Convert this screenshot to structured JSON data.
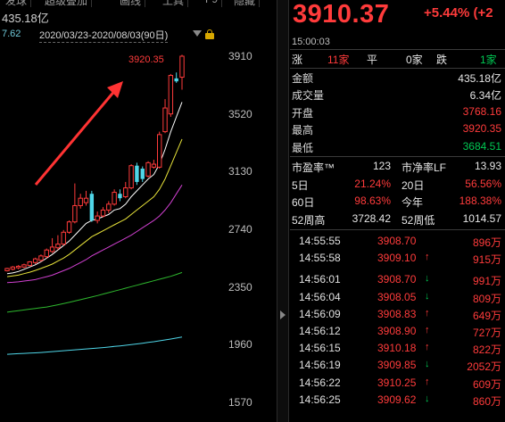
{
  "top_tabs": [
    "发球",
    "超级叠加",
    "画线",
    "工具",
    "F9",
    "隐藏"
  ],
  "amount_info": "435.18亿",
  "range": {
    "prev_value": "7.62",
    "date_range": "2020/03/23-2020/08/03(90日)"
  },
  "chart_data": {
    "type": "candlestick",
    "y_ticks": [
      "3910",
      "3520",
      "3130",
      "2740",
      "2350",
      "1960",
      "1570"
    ],
    "y_tick_values": [
      3910,
      3520,
      3130,
      2740,
      2350,
      1960,
      1570
    ],
    "high_label": "3920.35",
    "high_value": 3920.35,
    "ylim": [
      1400,
      4070
    ],
    "candles": [
      {
        "o": 2460,
        "c": 2475,
        "h": 2480,
        "l": 2455,
        "up": true
      },
      {
        "o": 2470,
        "c": 2485,
        "h": 2492,
        "l": 2462,
        "up": true
      },
      {
        "o": 2480,
        "c": 2490,
        "h": 2498,
        "l": 2470,
        "up": true
      },
      {
        "o": 2485,
        "c": 2500,
        "h": 2508,
        "l": 2478,
        "up": true
      },
      {
        "o": 2495,
        "c": 2520,
        "h": 2525,
        "l": 2490,
        "up": true
      },
      {
        "o": 2515,
        "c": 2540,
        "h": 2548,
        "l": 2505,
        "up": true
      },
      {
        "o": 2530,
        "c": 2560,
        "h": 2570,
        "l": 2520,
        "up": true
      },
      {
        "o": 2555,
        "c": 2600,
        "h": 2610,
        "l": 2545,
        "up": true
      },
      {
        "o": 2590,
        "c": 2620,
        "h": 2680,
        "l": 2580,
        "up": true
      },
      {
        "o": 2615,
        "c": 2640,
        "h": 2700,
        "l": 2600,
        "up": true
      },
      {
        "o": 2640,
        "c": 2720,
        "h": 2735,
        "l": 2630,
        "up": true
      },
      {
        "o": 2720,
        "c": 2790,
        "h": 2800,
        "l": 2710,
        "up": true
      },
      {
        "o": 2790,
        "c": 2900,
        "h": 3050,
        "l": 2780,
        "up": true
      },
      {
        "o": 2900,
        "c": 2950,
        "h": 2980,
        "l": 2880,
        "up": true
      },
      {
        "o": 2950,
        "c": 2920,
        "h": 3000,
        "l": 2900,
        "up": true
      },
      {
        "o": 2980,
        "c": 2800,
        "h": 3000,
        "l": 2790,
        "up": false
      },
      {
        "o": 2800,
        "c": 2830,
        "h": 2860,
        "l": 2780,
        "up": true
      },
      {
        "o": 2830,
        "c": 2870,
        "h": 2890,
        "l": 2820,
        "up": true
      },
      {
        "o": 2870,
        "c": 2910,
        "h": 2930,
        "l": 2850,
        "up": true
      },
      {
        "o": 2910,
        "c": 2990,
        "h": 3010,
        "l": 2900,
        "up": true
      },
      {
        "o": 2980,
        "c": 2950,
        "h": 3010,
        "l": 2930,
        "up": false
      },
      {
        "o": 2960,
        "c": 3020,
        "h": 3060,
        "l": 2950,
        "up": true
      },
      {
        "o": 3020,
        "c": 3170,
        "h": 3180,
        "l": 3010,
        "up": true
      },
      {
        "o": 3170,
        "c": 3060,
        "h": 3190,
        "l": 3040,
        "up": false
      },
      {
        "o": 3080,
        "c": 3150,
        "h": 3165,
        "l": 3060,
        "up": false
      },
      {
        "o": 3100,
        "c": 3190,
        "h": 3200,
        "l": 3090,
        "up": true
      },
      {
        "o": 3180,
        "c": 3160,
        "h": 3210,
        "l": 3150,
        "up": true
      },
      {
        "o": 3160,
        "c": 3380,
        "h": 3400,
        "l": 3150,
        "up": true
      },
      {
        "o": 3400,
        "c": 3560,
        "h": 3620,
        "l": 3390,
        "up": true
      },
      {
        "o": 3520,
        "c": 3780,
        "h": 3790,
        "l": 3500,
        "up": true
      },
      {
        "o": 3760,
        "c": 3740,
        "h": 3800,
        "l": 3730,
        "up": false
      },
      {
        "o": 3768,
        "c": 3910,
        "h": 3920,
        "l": 3684,
        "up": true
      }
    ],
    "ma_series": [
      {
        "color": "#ffffff",
        "values": [
          2440,
          2445,
          2455,
          2470,
          2485,
          2500,
          2520,
          2545,
          2570,
          2600,
          2630,
          2660,
          2700,
          2740,
          2780,
          2800,
          2810,
          2825,
          2840,
          2870,
          2880,
          2910,
          2960,
          3000,
          3040,
          3080,
          3110,
          3180,
          3280,
          3400,
          3500,
          3600
        ]
      },
      {
        "color": "#e8e33a",
        "values": [
          2420,
          2425,
          2430,
          2440,
          2450,
          2462,
          2475,
          2490,
          2505,
          2525,
          2545,
          2570,
          2600,
          2630,
          2660,
          2690,
          2710,
          2730,
          2750,
          2770,
          2790,
          2810,
          2840,
          2870,
          2900,
          2930,
          2960,
          3010,
          3080,
          3170,
          3260,
          3350
        ]
      },
      {
        "color": "#d040d0",
        "values": [
          2380,
          2382,
          2385,
          2390,
          2395,
          2400,
          2410,
          2420,
          2430,
          2445,
          2460,
          2475,
          2495,
          2515,
          2535,
          2560,
          2580,
          2600,
          2620,
          2640,
          2660,
          2680,
          2700,
          2725,
          2750,
          2775,
          2800,
          2830,
          2870,
          2920,
          2980,
          3040
        ]
      },
      {
        "color": "#2eb82e",
        "values": [
          2180,
          2185,
          2190,
          2195,
          2200,
          2205,
          2210,
          2215,
          2222,
          2230,
          2238,
          2246,
          2255,
          2264,
          2273,
          2282,
          2292,
          2302,
          2312,
          2322,
          2332,
          2342,
          2352,
          2362,
          2372,
          2382,
          2392,
          2402,
          2412,
          2422,
          2435,
          2448
        ]
      },
      {
        "color": "#4fd6e8",
        "values": [
          1895,
          1897,
          1899,
          1901,
          1903,
          1905,
          1907,
          1910,
          1913,
          1916,
          1919,
          1922,
          1925,
          1928,
          1931,
          1934,
          1937,
          1940,
          1944,
          1948,
          1952,
          1956,
          1960,
          1965,
          1970,
          1975,
          1980,
          1986,
          1992,
          1998,
          2005,
          2012
        ]
      }
    ]
  },
  "quote": {
    "price": "3910.37",
    "change": "+5.44% (+2",
    "time": "15:00:03",
    "breadth": {
      "up_label": "涨",
      "up_count": "11家",
      "flat_label": "平",
      "flat_count": "0家",
      "down_label": "跌",
      "down_count": "1家"
    },
    "stats": [
      {
        "label": "金额",
        "value": "435.18亿",
        "color": "white"
      },
      {
        "label": "成交量",
        "value": "6.34亿",
        "color": "white"
      },
      {
        "label": "开盘",
        "value": "3768.16",
        "color": "red"
      },
      {
        "label": "最高",
        "value": "3920.35",
        "color": "red"
      },
      {
        "label": "最低",
        "value": "3684.51",
        "color": "green"
      }
    ],
    "grid": [
      {
        "l1": "市盈率™",
        "v1": "123",
        "c1": "white",
        "l2": "市净率LF",
        "v2": "13.93",
        "c2": "white"
      },
      {
        "l1": "5日",
        "v1": "21.24%",
        "c1": "red",
        "l2": "20日",
        "v2": "56.56%",
        "c2": "red"
      },
      {
        "l1": "60日",
        "v1": "98.63%",
        "c1": "red",
        "l2": "今年",
        "v2": "188.38%",
        "c2": "red"
      },
      {
        "l1": "52周高",
        "v1": "3728.42",
        "c1": "white",
        "l2": "52周低",
        "v2": "1014.57",
        "c2": "white"
      }
    ],
    "trades": [
      {
        "time": "14:55:55",
        "price": "3908.70",
        "dir": "",
        "vol": "896万",
        "pc": "red"
      },
      {
        "time": "14:55:58",
        "price": "3909.10",
        "dir": "up",
        "vol": "915万",
        "pc": "red"
      },
      {
        "time": "14:56:01",
        "price": "3908.70",
        "dir": "down",
        "vol": "991万",
        "pc": "red"
      },
      {
        "time": "14:56:04",
        "price": "3908.05",
        "dir": "down",
        "vol": "809万",
        "pc": "red"
      },
      {
        "time": "14:56:09",
        "price": "3908.83",
        "dir": "up",
        "vol": "649万",
        "pc": "red"
      },
      {
        "time": "14:56:12",
        "price": "3908.90",
        "dir": "up",
        "vol": "727万",
        "pc": "red"
      },
      {
        "time": "14:56:15",
        "price": "3910.18",
        "dir": "up",
        "vol": "822万",
        "pc": "red"
      },
      {
        "time": "14:56:19",
        "price": "3909.85",
        "dir": "down",
        "vol": "2052万",
        "pc": "red"
      },
      {
        "time": "14:56:22",
        "price": "3910.25",
        "dir": "up",
        "vol": "609万",
        "pc": "red"
      },
      {
        "time": "14:56:25",
        "price": "3909.62",
        "dir": "down",
        "vol": "860万",
        "pc": "red"
      }
    ]
  },
  "colors": {
    "up": "#ff3b3b",
    "down": "#4fd6e8",
    "down_arrow": "#00c853",
    "annotation": "#ff3333"
  }
}
